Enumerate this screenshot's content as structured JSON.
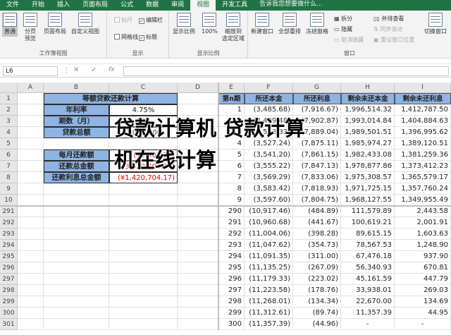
{
  "tabs": [
    "文件",
    "开始",
    "插入",
    "页面布局",
    "公式",
    "数据",
    "审阅",
    "视图",
    "开发工具"
  ],
  "active_tab": "视图",
  "tell_me": "告诉我您想要做什么...",
  "ribbon": {
    "workbook_views": {
      "label": "工作簿视图",
      "normal": "普通",
      "page_break_line1": "分页",
      "page_break_line2": "预览",
      "page_layout": "页面布局",
      "custom_views": "自定义视图"
    },
    "show": {
      "label": "显示",
      "ruler": "标尺",
      "formula_bar": "编辑栏",
      "gridlines": "网格线",
      "headings": "标题"
    },
    "zoom": {
      "label": "显示比例",
      "zoom": "显示比例",
      "hundred": "100%",
      "to_selection_line1": "缩放到",
      "to_selection_line2": "选定区域"
    },
    "window": {
      "label": "窗口",
      "new_window": "新建窗口",
      "arrange_all": "全部重排",
      "freeze": "冻结窗格",
      "split": "拆分",
      "hide": "隐藏",
      "unhide": "取消隐藏",
      "side_by_side": "并排查看",
      "sync_scroll": "同步滚动",
      "reset_position": "重设窗口位置",
      "switch_windows": "切换窗口"
    }
  },
  "formula_bar": {
    "name_box": "L6",
    "cancel": "✕",
    "enter": "✓",
    "fx": "fx",
    "content": ""
  },
  "columns": [
    "A",
    "B",
    "C",
    "D",
    "E",
    "F",
    "G",
    "H",
    "I"
  ],
  "left_table": {
    "title": "等额贷款还款计算",
    "rows": [
      {
        "label": "年利率",
        "value": "4.75%"
      },
      {
        "label": "期数（月）",
        "value": "300"
      },
      {
        "label": "贷款总额",
        "value": "2,000,000"
      }
    ],
    "results": [
      {
        "label": "每月还款额",
        "value": "(11,402.37)"
      },
      {
        "label": "还款总金额",
        "value": "(3,420,704.17)"
      },
      {
        "label": "还款利息总金额",
        "value": "(¥1,420,704.17)"
      }
    ]
  },
  "right_table": {
    "headers": [
      "第n期",
      "所还本金",
      "所还利息",
      "剩余未还本金",
      "剩余未还利息"
    ],
    "rows": [
      {
        "row": "2",
        "n": "1",
        "principal": "(3,485.68)",
        "interest": "(7,916.67)",
        "rem_principal": "1,996,514.32",
        "rem_interest": "1,412,787.50"
      },
      {
        "row": "3",
        "n": "2",
        "principal": "(3,499.48)",
        "interest": "(7,902.87)",
        "rem_principal": "1,993,014.84",
        "rem_interest": "1,404,884.63"
      },
      {
        "row": "4",
        "n": "3",
        "principal": "(3,513.33)",
        "interest": "(7,889.04)",
        "rem_principal": "1,989,501.51",
        "rem_interest": "1,396,995.62"
      },
      {
        "row": "5",
        "n": "4",
        "principal": "(3,527.24)",
        "interest": "(7,875.11)",
        "rem_principal": "1,985,974.27",
        "rem_interest": "1,389,120.51"
      },
      {
        "row": "6",
        "n": "5",
        "principal": "(3,541.20)",
        "interest": "(7,861.15)",
        "rem_principal": "1,982,433.08",
        "rem_interest": "1,381,259.36"
      },
      {
        "row": "7",
        "n": "6",
        "principal": "(3,555.22)",
        "interest": "(7,847.13)",
        "rem_principal": "1,978,877.86",
        "rem_interest": "1,373,412.23"
      },
      {
        "row": "8",
        "n": "7",
        "principal": "(3,569.29)",
        "interest": "(7,833.06)",
        "rem_principal": "1,975,308.57",
        "rem_interest": "1,365,579.17"
      },
      {
        "row": "9",
        "n": "8",
        "principal": "(3,583.42)",
        "interest": "(7,818.93)",
        "rem_principal": "1,971,725.15",
        "rem_interest": "1,357,760.24"
      },
      {
        "row": "10",
        "n": "9",
        "principal": "(3,597.60)",
        "interest": "(7,804.75)",
        "rem_principal": "1,968,127.55",
        "rem_interest": "1,349,955.49"
      },
      {
        "row": "291",
        "n": "290",
        "principal": "(10,917.46)",
        "interest": "(484.89)",
        "rem_principal": "111,579.89",
        "rem_interest": "2,443.58"
      },
      {
        "row": "292",
        "n": "291",
        "principal": "(10,960.68)",
        "interest": "(441.67)",
        "rem_principal": "100,619.21",
        "rem_interest": "2,001.91"
      },
      {
        "row": "293",
        "n": "292",
        "principal": "(11,004.06)",
        "interest": "(398.28)",
        "rem_principal": "89,615.15",
        "rem_interest": "1,603.63"
      },
      {
        "row": "294",
        "n": "293",
        "principal": "(11,047.62)",
        "interest": "(354.73)",
        "rem_principal": "78,567.53",
        "rem_interest": "1,248.90"
      },
      {
        "row": "295",
        "n": "294",
        "principal": "(11,091.35)",
        "interest": "(311.00)",
        "rem_principal": "67,476.18",
        "rem_interest": "937.90"
      },
      {
        "row": "296",
        "n": "295",
        "principal": "(11,135.25)",
        "interest": "(267.09)",
        "rem_principal": "56,340.93",
        "rem_interest": "670.81"
      },
      {
        "row": "297",
        "n": "296",
        "principal": "(11,179.33)",
        "interest": "(223.02)",
        "rem_principal": "45,161.59",
        "rem_interest": "447.79"
      },
      {
        "row": "298",
        "n": "297",
        "principal": "(11,223.58)",
        "interest": "(178.76)",
        "rem_principal": "33,938.01",
        "rem_interest": "269.03"
      },
      {
        "row": "299",
        "n": "298",
        "principal": "(11,268.01)",
        "interest": "(134.34)",
        "rem_principal": "22,670.00",
        "rem_interest": "134.69"
      },
      {
        "row": "300",
        "n": "299",
        "principal": "(11,312.61)",
        "interest": "(89.74)",
        "rem_principal": "11,357.39",
        "rem_interest": "44.95"
      },
      {
        "row": "301",
        "n": "300",
        "principal": "(11,357.39)",
        "interest": "(44.96)",
        "rem_principal": "-",
        "rem_interest": "-"
      }
    ]
  },
  "watermark": {
    "line1": "贷款计算机 贷款计算",
    "line2": "机在线计算"
  }
}
